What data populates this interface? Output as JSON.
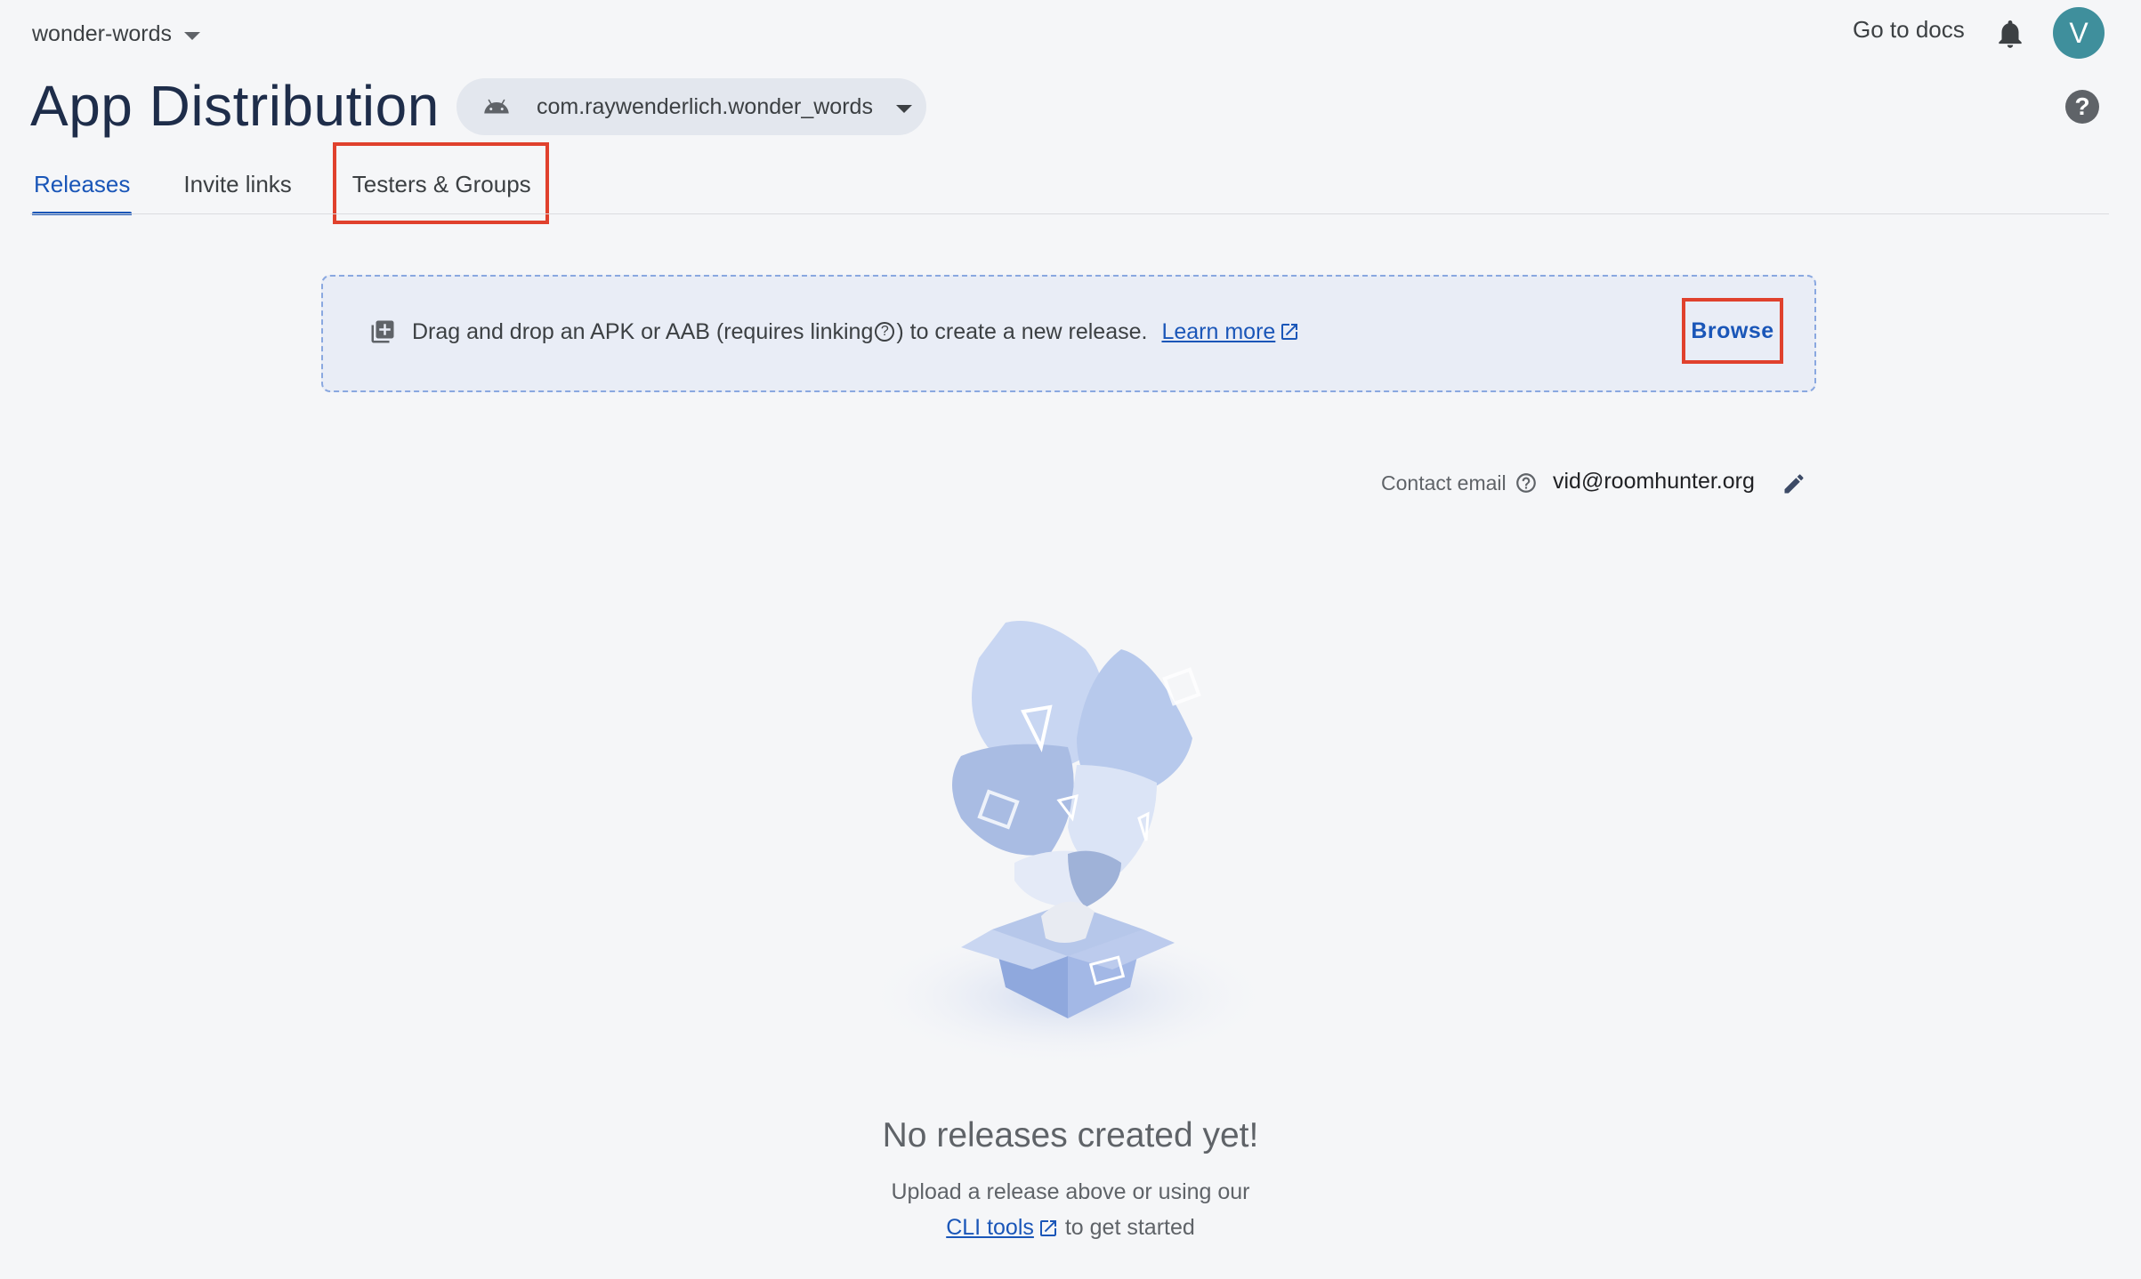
{
  "topbar": {
    "project_name": "wonder-words",
    "docs_label": "Go to docs",
    "avatar_initial": "V"
  },
  "header": {
    "title": "App Distribution",
    "app_id": "com.raywenderlich.wonder_words"
  },
  "tabs": [
    {
      "label": "Releases",
      "active": true
    },
    {
      "label": "Invite links",
      "active": false
    },
    {
      "label": "Testers & Groups",
      "active": false
    }
  ],
  "dropzone": {
    "text_before": "Drag and drop an APK or AAB (requires linking",
    "text_after": ") to create a new release.",
    "learn_more": "Learn more",
    "browse": "Browse"
  },
  "contact": {
    "label": "Contact email",
    "email": "vid@roomhunter.org"
  },
  "empty_state": {
    "title": "No releases created yet!",
    "line1": "Upload a release above or using our",
    "cli_link": "CLI tools",
    "line2_suffix": "to get started"
  },
  "colors": {
    "accent": "#1a56b8",
    "highlight_box": "#e0412d",
    "avatar_bg": "#3f8f9c"
  }
}
